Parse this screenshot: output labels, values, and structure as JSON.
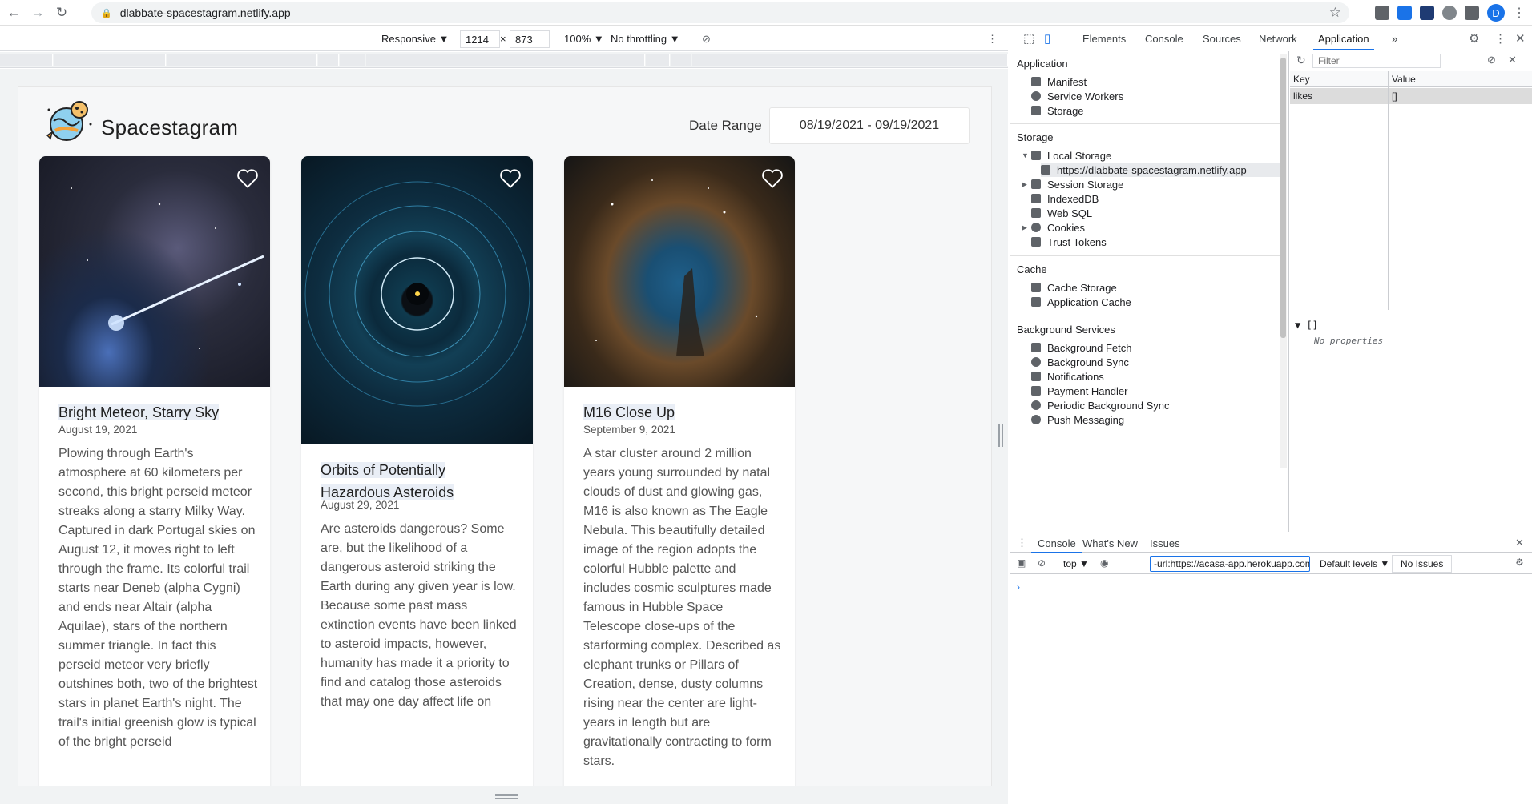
{
  "browser": {
    "url": "dlabbate-spacestagram.netlify.app",
    "profile_initial": "D"
  },
  "device_toolbar": {
    "mode": "Responsive ▼",
    "width": "1214",
    "times": "×",
    "height": "873",
    "zoom": "100% ▼",
    "throttle": "No throttling ▼"
  },
  "app": {
    "title": "Spacestagram",
    "date_label": "Date Range",
    "date_value": "08/19/2021 - 09/19/2021",
    "cards": [
      {
        "title": "Bright Meteor, Starry Sky",
        "date": "August 19, 2021",
        "text": "Plowing through Earth's atmosphere at 60 kilometers per second, this bright perseid meteor streaks along a starry Milky Way. Captured in dark Portugal skies on August 12, it moves right to left through the frame. Its colorful trail starts near Deneb (alpha Cygni) and ends near Altair (alpha Aquilae), stars of the northern summer triangle. In fact this perseid meteor very briefly outshines both, two of the brightest stars in planet Earth's night. The trail's initial greenish glow is typical of the bright perseid"
      },
      {
        "title": "Orbits of Potentially Hazardous Asteroids",
        "date": "August 29, 2021",
        "text": "Are asteroids dangerous? Some are, but the likelihood of a dangerous asteroid striking the Earth during any given year is low. Because some past mass extinction events have been linked to asteroid impacts, however, humanity has made it a priority to find and catalog those asteroids that may one day affect life on"
      },
      {
        "title": "M16 Close Up",
        "date": "September 9, 2021",
        "text": "A star cluster around 2 million years young surrounded by natal clouds of dust and glowing gas, M16 is also known as The Eagle Nebula. This beautifully detailed image of the region adopts the colorful Hubble palette and includes cosmic sculptures made famous in Hubble Space Telescope close-ups of the starforming complex. Described as elephant trunks or Pillars of Creation, dense, dusty columns rising near the center are light-years in length but are gravitationally contracting to form stars."
      }
    ]
  },
  "devtools": {
    "tabs": [
      "Elements",
      "Console",
      "Sources",
      "Network",
      "Application"
    ],
    "more": "»",
    "sections": {
      "application": {
        "title": "Application",
        "items": [
          "Manifest",
          "Service Workers",
          "Storage"
        ]
      },
      "storage": {
        "title": "Storage",
        "items": [
          "Local Storage",
          "https://dlabbate-spacestagram.netlify.app",
          "Session Storage",
          "IndexedDB",
          "Web SQL",
          "Cookies",
          "Trust Tokens"
        ]
      },
      "cache": {
        "title": "Cache",
        "items": [
          "Cache Storage",
          "Application Cache"
        ]
      },
      "background": {
        "title": "Background Services",
        "items": [
          "Background Fetch",
          "Background Sync",
          "Notifications",
          "Payment Handler",
          "Periodic Background Sync",
          "Push Messaging"
        ]
      }
    },
    "kv": {
      "filter_placeholder": "Filter",
      "key_header": "Key",
      "value_header": "Value",
      "row_key": "likes",
      "row_value": "[]",
      "tree_label": "▼ []",
      "no_props": "No properties"
    },
    "drawer": {
      "tabs": [
        "Console",
        "What's New",
        "Issues"
      ],
      "context": "top ▼",
      "filter_value": "-url:https://acasa-app.herokuapp.com/",
      "levels": "Default levels ▼",
      "issues": "No Issues",
      "prompt": "›"
    }
  }
}
